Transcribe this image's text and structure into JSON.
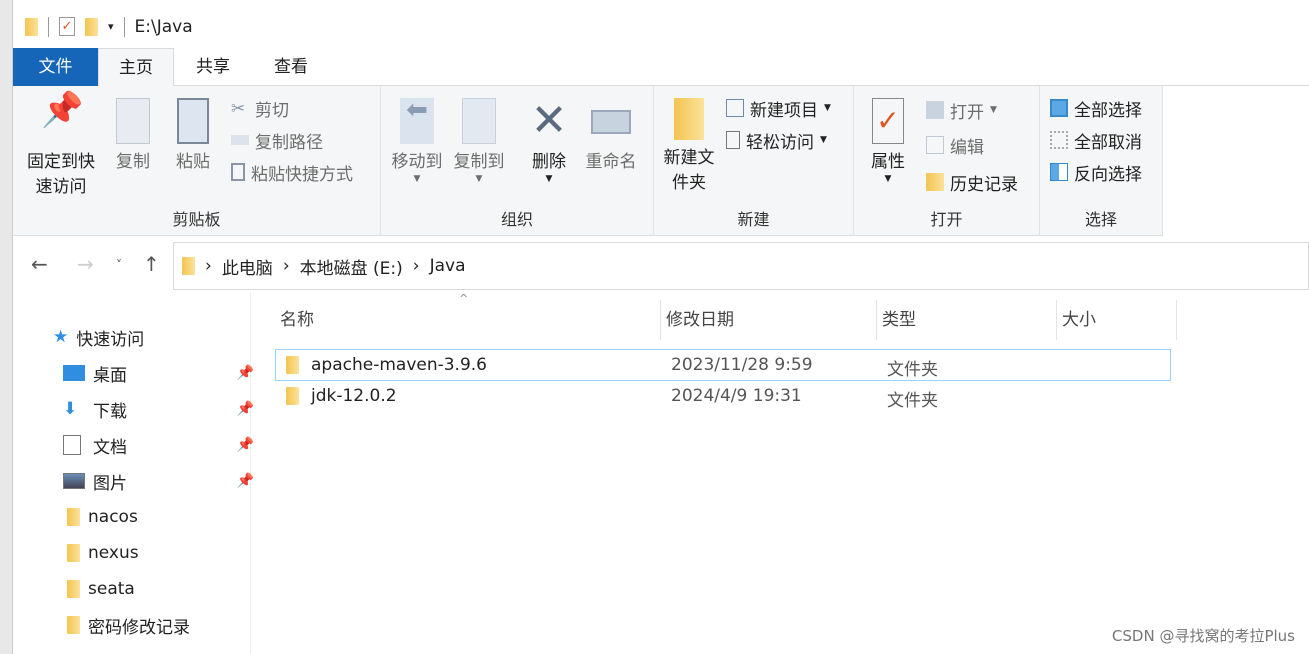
{
  "window": {
    "title": "E:\\Java"
  },
  "tabs": [
    {
      "label": "文件"
    },
    {
      "label": "主页"
    },
    {
      "label": "共享"
    },
    {
      "label": "查看"
    }
  ],
  "ribbon": {
    "clipboard": {
      "label": "剪贴板",
      "pin": "固定到快速访问",
      "copy": "复制",
      "paste": "粘贴",
      "cut": "剪切",
      "copy_path": "复制路径",
      "paste_shortcut": "粘贴快捷方式"
    },
    "organize": {
      "label": "组织",
      "move_to": "移动到",
      "copy_to": "复制到",
      "delete": "删除",
      "rename": "重命名"
    },
    "new": {
      "label": "新建",
      "new_folder": "新建文件夹",
      "new_item": "新建项目",
      "easy_access": "轻松访问"
    },
    "open": {
      "label": "打开",
      "properties": "属性",
      "open": "打开",
      "edit": "编辑",
      "history": "历史记录"
    },
    "select": {
      "label": "选择",
      "select_all": "全部选择",
      "select_none": "全部取消",
      "invert": "反向选择"
    }
  },
  "breadcrumb": [
    "此电脑",
    "本地磁盘 (E:)",
    "Java"
  ],
  "sidebar": {
    "quick_access": "快速访问",
    "items": [
      {
        "label": "桌面",
        "pinned": true
      },
      {
        "label": "下载",
        "pinned": true
      },
      {
        "label": "文档",
        "pinned": true
      },
      {
        "label": "图片",
        "pinned": true
      },
      {
        "label": "nacos"
      },
      {
        "label": "nexus"
      },
      {
        "label": "seata"
      },
      {
        "label": "密码修改记录"
      }
    ]
  },
  "columns": [
    "名称",
    "修改日期",
    "类型",
    "大小"
  ],
  "files": [
    {
      "name": "apache-maven-3.9.6",
      "modified": "2023/11/28 9:59",
      "type": "文件夹",
      "size": ""
    },
    {
      "name": "jdk-12.0.2",
      "modified": "2024/4/9 19:31",
      "type": "文件夹",
      "size": ""
    }
  ],
  "watermark": "CSDN @寻找窝的考拉Plus",
  "colors": {
    "file_tab": "#1565b8",
    "selection": "#99d1ff",
    "folder": "#f3c451"
  }
}
